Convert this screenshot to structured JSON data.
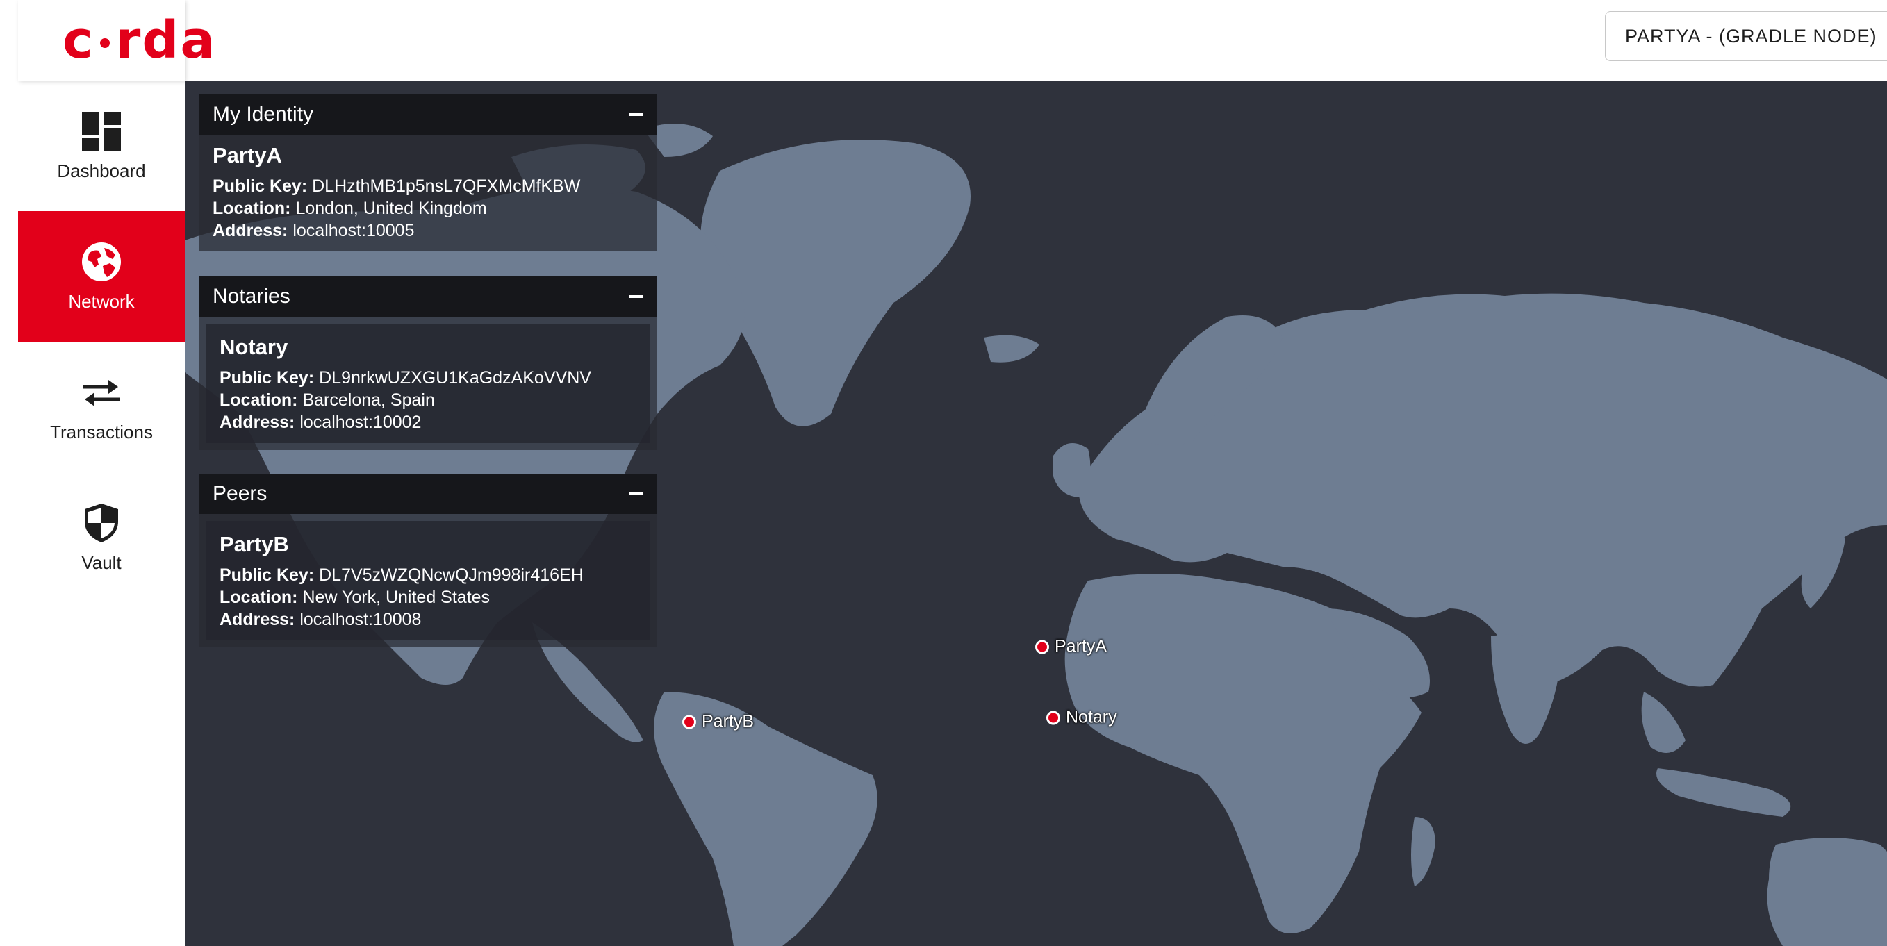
{
  "header": {
    "logo_left": "c",
    "logo_right": "rda",
    "node_label": "PARTYA - (GRADLE NODE)"
  },
  "sidebar": {
    "items": [
      {
        "label": "Dashboard",
        "icon": "dashboard-icon",
        "active": false
      },
      {
        "label": "Network",
        "icon": "globe-icon",
        "active": true
      },
      {
        "label": "Transactions",
        "icon": "transfer-arrows-icon",
        "active": false
      },
      {
        "label": "Vault",
        "icon": "shield-icon",
        "active": false
      }
    ]
  },
  "labels": {
    "public_key": "Public Key:",
    "location": "Location:",
    "address": "Address:"
  },
  "panels": {
    "identity": {
      "title": "My Identity",
      "node": {
        "name": "PartyA",
        "public_key": "DLHzthMB1p5nsL7QFXMcMfKBW",
        "location": "London, United Kingdom",
        "address": "localhost:10005"
      }
    },
    "notaries": {
      "title": "Notaries",
      "node": {
        "name": "Notary",
        "public_key": "DL9nrkwUZXGU1KaGdzAKoVVNV",
        "location": "Barcelona, Spain",
        "address": "localhost:10002"
      }
    },
    "peers": {
      "title": "Peers",
      "node": {
        "name": "PartyB",
        "public_key": "DL7V5zWZQNcwQJm998ir416EH",
        "location": "New York, United States",
        "address": "localhost:10008"
      }
    }
  },
  "map": {
    "markers": [
      {
        "label": "PartyA"
      },
      {
        "label": "Notary"
      },
      {
        "label": "PartyB"
      }
    ],
    "colors": {
      "ocean": "#2f323c",
      "land": "#6e7d92",
      "marker": "#e2001a",
      "accent": "#e2001a"
    }
  }
}
